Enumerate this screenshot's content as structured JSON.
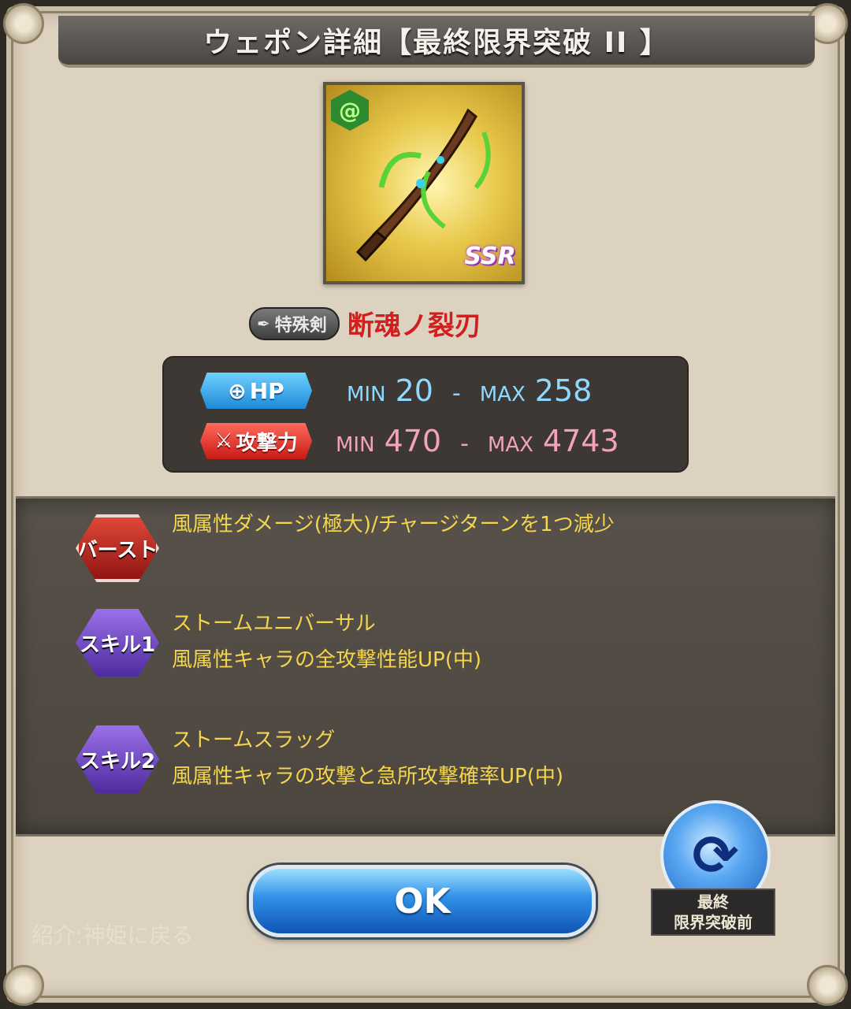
{
  "dialog": {
    "title": "ウェポン詳細【最終限界突破 II 】"
  },
  "weapon": {
    "element": "wind",
    "element_icon": "wind-element-icon",
    "rarity": "SSR",
    "type_label": "特殊剣",
    "name": "断魂ノ裂刃"
  },
  "stats": {
    "hp": {
      "label": "HP",
      "min_label": "MIN",
      "min": "20",
      "sep": "-",
      "max_label": "MAX",
      "max": "258"
    },
    "atk": {
      "label": "攻撃力",
      "min_label": "MIN",
      "min": "470",
      "sep": "-",
      "max_label": "MAX",
      "max": "4743"
    }
  },
  "skills": [
    {
      "badge": "バースト",
      "name": "",
      "description": "風属性ダメージ(極大)/チャージターンを1つ減少"
    },
    {
      "badge": "スキル1",
      "name": "ストームユニバーサル",
      "description": "風属性キャラの全攻撃性能UP(中)"
    },
    {
      "badge": "スキル2",
      "name": "ストームスラッグ",
      "description": "風属性キャラの攻撃と急所攻撃確率UP(中)"
    }
  ],
  "footer": {
    "ok_label": "OK",
    "back_text": "紹介:神姫に戻る",
    "uncap_toggle_label_1": "最終",
    "uncap_toggle_label_2": "限界突破前"
  },
  "colors": {
    "weapon_name": "#d11e1e",
    "skill_text": "#f3d54e",
    "hp_value": "#8fd8ff",
    "atk_value": "#f2a3b8"
  }
}
